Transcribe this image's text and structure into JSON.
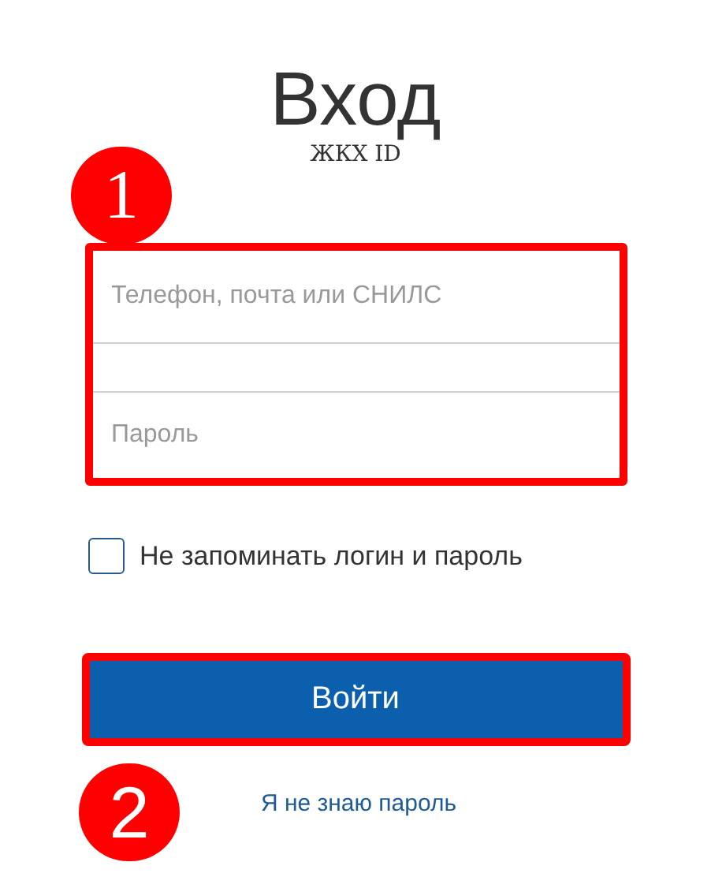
{
  "title": "Вход",
  "subtitle": "ЖКХ ID",
  "fields": [
    {
      "placeholder": "Телефон, почта или СНИЛС"
    },
    {
      "placeholder": "Пароль"
    }
  ],
  "remember": {
    "label": "Не запоминать логин и пароль",
    "checked": false
  },
  "submit": {
    "label": "Войти"
  },
  "forgot_link": "Я не знаю пароль",
  "annotations": [
    {
      "label": "1"
    },
    {
      "label": "2"
    }
  ]
}
